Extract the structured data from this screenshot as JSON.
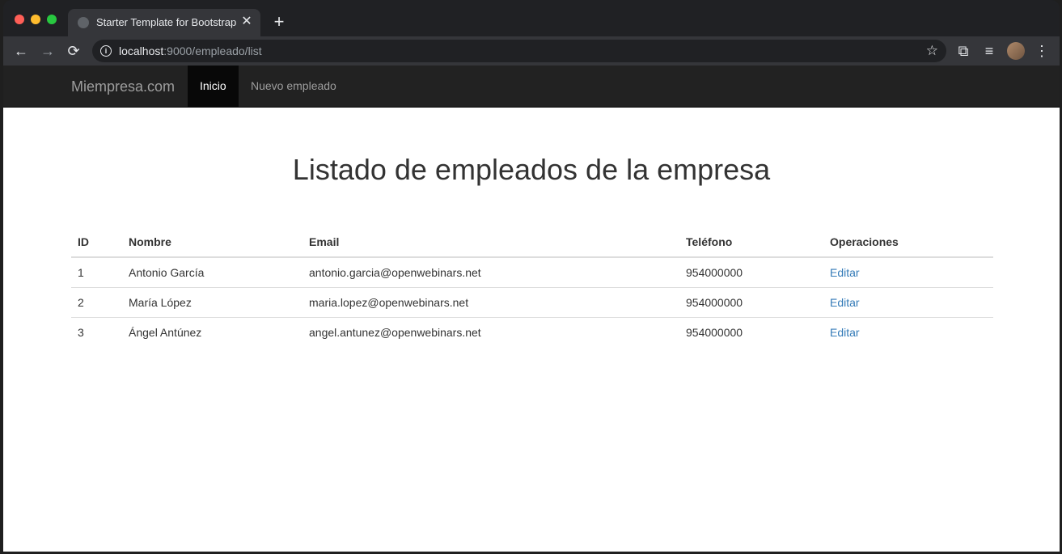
{
  "browser": {
    "tab_title": "Starter Template for Bootstrap",
    "close_glyph": "✕",
    "new_tab_glyph": "+",
    "url_host": "localhost",
    "url_rest": ":9000/empleado/list",
    "icons": {
      "back": "←",
      "forward": "→",
      "reload": "⟳",
      "info": "i",
      "star": "☆",
      "extensions": "⧉",
      "media": "≡",
      "menu": "⋮"
    }
  },
  "navbar": {
    "brand": "Miempresa.com",
    "items": [
      {
        "label": "Inicio",
        "active": true
      },
      {
        "label": "Nuevo empleado",
        "active": false
      }
    ]
  },
  "main": {
    "heading": "Listado de empleados de la empresa",
    "table": {
      "headers": [
        "ID",
        "Nombre",
        "Email",
        "Teléfono",
        "Operaciones"
      ],
      "rows": [
        {
          "id": "1",
          "nombre": "Antonio García",
          "email": "antonio.garcia@openwebinars.net",
          "telefono": "954000000",
          "accion": "Editar"
        },
        {
          "id": "2",
          "nombre": "María López",
          "email": "maria.lopez@openwebinars.net",
          "telefono": "954000000",
          "accion": "Editar"
        },
        {
          "id": "3",
          "nombre": "Ángel Antúnez",
          "email": "angel.antunez@openwebinars.net",
          "telefono": "954000000",
          "accion": "Editar"
        }
      ]
    }
  },
  "colors": {
    "navbar_bg": "#222222",
    "active_nav_bg": "#080808",
    "link": "#337ab7"
  }
}
